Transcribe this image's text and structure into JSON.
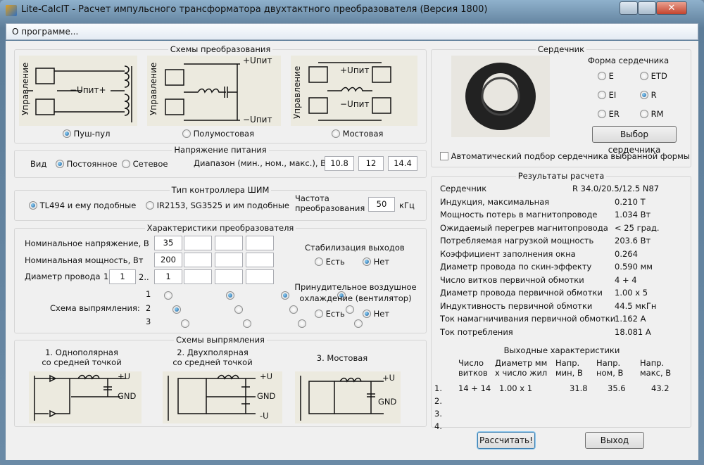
{
  "window": {
    "title": "Lite-CalcIT - Расчет импульсного трансформатора двухтактного преобразователя (Версия 1800)",
    "close": "✕"
  },
  "menu": {
    "about": "О программе..."
  },
  "schemes": {
    "title": "Схемы  преобразования",
    "control": "Управление",
    "items": [
      {
        "label": "Пуш-пул",
        "selected": true,
        "v": "−Uпит+"
      },
      {
        "label": "Полумостовая",
        "selected": false,
        "vp": "+Uпит",
        "vm": "−Uпит"
      },
      {
        "label": "Мостовая",
        "selected": false,
        "vp": "+Uпит",
        "vm": "−Uпит"
      }
    ]
  },
  "supply": {
    "title": "Напряжение питания",
    "kind_label": "Вид",
    "dc": "Постоянное",
    "mains": "Сетевое",
    "dc_selected": true,
    "range_label": "Диапазон (мин., ном., макс.), В",
    "min": "10.8",
    "nom": "12",
    "max": "14.4"
  },
  "pwm": {
    "title": "Тип контроллера ШИМ",
    "opt1": "TL494 и ему подобные",
    "opt2": "IR2153, SG3525 и им подобные",
    "freq_label1": "Частота",
    "freq_label2": "преобразования",
    "freq": "50",
    "freq_unit": "кГц"
  },
  "conv": {
    "title": "Характеристики преобразователя",
    "nom_v_label": "Номинальное напряжение, В",
    "nom_v": [
      "35",
      "",
      "",
      ""
    ],
    "nom_p_label": "Номинальная мощность, Вт",
    "nom_p": [
      "200",
      "",
      "",
      ""
    ],
    "wire_label": "Диаметр провода",
    "wire_1_idx": "1",
    "wire_1": "1",
    "wire_2_idx": "2..",
    "wire_2": [
      "1",
      "",
      "",
      ""
    ],
    "rect_label": "Схема выпрямления:",
    "rect_rows": [
      "1",
      "2",
      "3"
    ],
    "rect_sel": [
      2,
      1,
      1,
      1
    ],
    "stab_label": "Стабилизация выходов",
    "yes": "Есть",
    "no": "Нет",
    "cool_label1": "Принудительное воздушное",
    "cool_label2": "охлаждение (вентилятор)"
  },
  "rect": {
    "title": "Схемы выпрямления",
    "s1a": "1. Однополярная",
    "s1b": "со средней точкой",
    "s2a": "2. Двухполярная",
    "s2b": "со средней точкой",
    "s3": "3. Мостовая",
    "plus": "+U",
    "gnd": "GND",
    "minus": "-U"
  },
  "core": {
    "title": "Сердечник",
    "shape_label": "Форма сердечника",
    "shapes": [
      "E",
      "ETD",
      "EI",
      "R",
      "ER",
      "RM"
    ],
    "selected": "R",
    "choose": "Выбор сердечника",
    "auto": "Автоматический подбор сердечника выбранной формы"
  },
  "results": {
    "title": "Результаты расчета",
    "rows": [
      [
        "Сердечник",
        "R 34.0/20.5/12.5 N87"
      ],
      [
        "Индукция, максимальная",
        "0.210 Т"
      ],
      [
        "Мощность потерь в магнитопроводе",
        "1.034 Вт"
      ],
      [
        "Ожидаемый перегрев магнитопровода",
        "< 25 град."
      ],
      [
        "Потребляемая нагрузкой мощность",
        "203.6 Вт"
      ],
      [
        "Коэффициент заполнения окна",
        "0.264"
      ],
      [
        "Диаметр провода по скин-эффекту",
        "0.590 мм"
      ],
      [
        "Число витков первичной обмотки",
        "4 + 4"
      ],
      [
        "Диаметр провода первичной обмотки",
        "1.00 x 5"
      ],
      [
        "Индуктивность первичной обмотки",
        "44.5 мкГн"
      ],
      [
        "Ток намагничивания первичной обмотки",
        "1.162 А"
      ],
      [
        "Ток потребления",
        "18.081 А"
      ]
    ],
    "out_title": "Выходные характеристики",
    "out_headers": [
      [
        "Число",
        "витков"
      ],
      [
        "Диаметр мм",
        "х число жил"
      ],
      [
        "Напр.",
        "мин, В"
      ],
      [
        "Напр.",
        "ном, В"
      ],
      [
        "Напр.",
        "макс, В"
      ]
    ],
    "out_rows": [
      [
        "1.",
        "14 + 14",
        "1.00 x 1",
        "31.8",
        "35.6",
        "43.2"
      ],
      [
        "2.",
        "",
        "",
        "",
        "",
        ""
      ],
      [
        "3.",
        "",
        "",
        "",
        "",
        ""
      ],
      [
        "4.",
        "",
        "",
        "",
        "",
        ""
      ]
    ]
  },
  "buttons": {
    "calc": "Рассчитать!",
    "exit": "Выход"
  }
}
